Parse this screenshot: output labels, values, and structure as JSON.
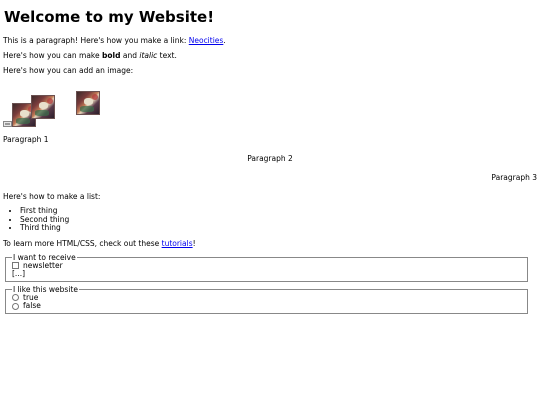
{
  "heading": "Welcome to my Website!",
  "p1": {
    "text": "This is a paragraph! Here's how you make a link: ",
    "link": "Neocities",
    "end": "."
  },
  "p2": {
    "a": "Here's how you can make ",
    "bold": "bold",
    "mid": " and ",
    "italic": "italic",
    "end": " text."
  },
  "p3": "Here's how you can add an image:",
  "para_left": "Paragraph 1",
  "para_center": "Paragraph 2",
  "para_right": "Paragraph 3",
  "list_intro": "Here's how to make a list:",
  "list": [
    "First thing",
    "Second thing",
    "Third thing"
  ],
  "learn": {
    "a": "To learn more HTML/CSS, check out these ",
    "link": "tutorials",
    "end": "!"
  },
  "fieldset1": {
    "legend": "I want to receive",
    "options": [
      "newsletter"
    ],
    "more": "[...]"
  },
  "fieldset2": {
    "legend": "I like this website",
    "options": [
      "true",
      "false"
    ]
  }
}
